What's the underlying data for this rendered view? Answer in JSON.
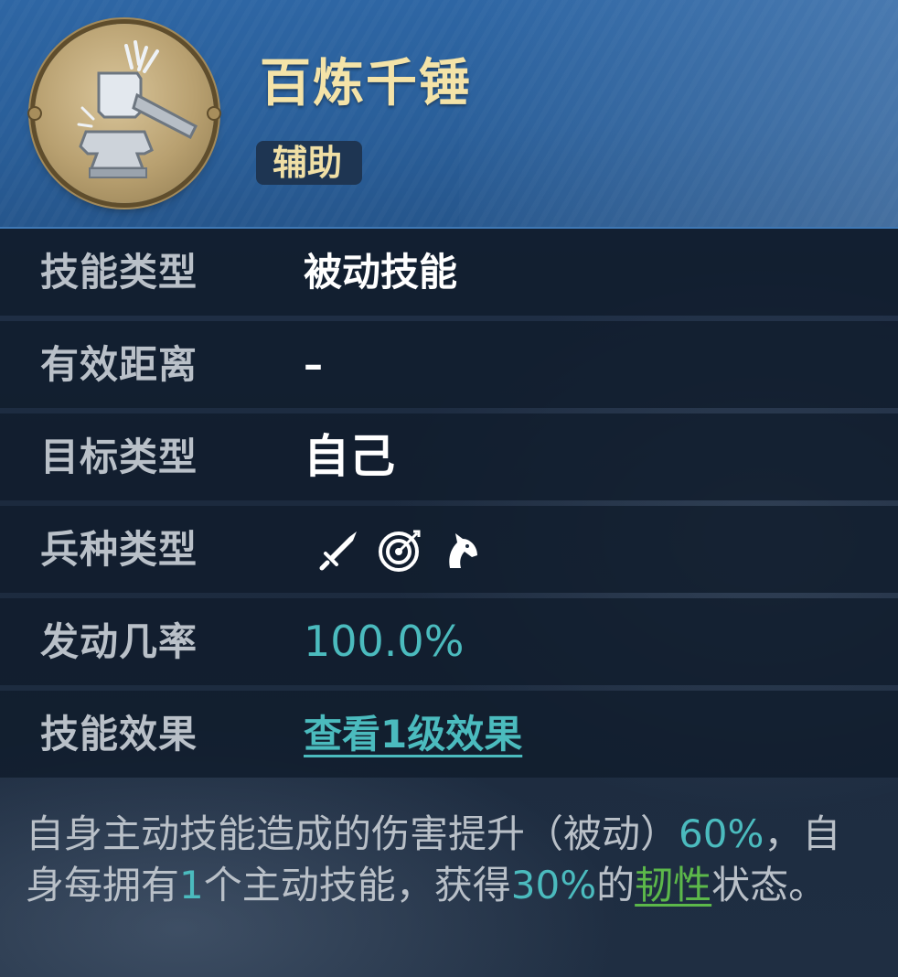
{
  "skill": {
    "name": "百炼千锤",
    "tag": "辅助",
    "icon": "hammer-anvil-icon"
  },
  "rows": [
    {
      "label": "技能类型",
      "value": "被动技能"
    },
    {
      "label": "有效距离",
      "value": "–"
    },
    {
      "label": "目标类型",
      "value": "自己"
    },
    {
      "label": "兵种类型",
      "icons": [
        "sword-icon",
        "archery-target-icon",
        "horse-head-icon"
      ]
    },
    {
      "label": "发动几率",
      "value": "100.0%"
    },
    {
      "label": "技能效果",
      "value": "查看1级效果"
    }
  ],
  "description": {
    "part1": "自身主动技能造成的伤害提升（被动）",
    "value1": "60%",
    "part2": "，自身每拥有",
    "value2": "1",
    "part3": "个主动技能，获得",
    "value3": "30%",
    "part4": "的",
    "keyword": "韧性",
    "part5": "状态。"
  },
  "colors": {
    "title": "#f4e3a8",
    "highlight": "#4bbbbe",
    "keyword": "#5cb84a",
    "label": "#b9c0c8"
  }
}
